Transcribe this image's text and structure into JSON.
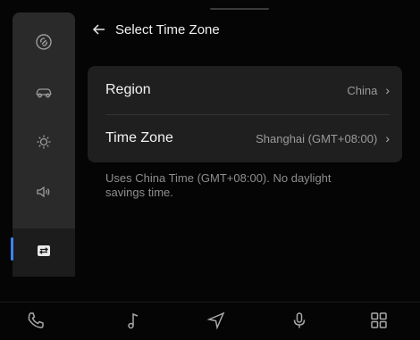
{
  "header": {
    "title": "Select Time Zone"
  },
  "sidebar": {
    "items": [
      {
        "icon": "link-icon"
      },
      {
        "icon": "car-icon"
      },
      {
        "icon": "brightness-icon"
      },
      {
        "icon": "volume-icon"
      },
      {
        "icon": "transfer-icon",
        "active": true
      }
    ]
  },
  "settings": {
    "region": {
      "label": "Region",
      "value": "China"
    },
    "time_zone": {
      "label": "Time Zone",
      "value": "Shanghai (GMT+08:00)"
    },
    "note": "Uses China Time (GMT+08:00). No daylight savings time."
  },
  "bottom_bar": {
    "items": [
      "phone-icon",
      "music-icon",
      "navigation-icon",
      "microphone-icon",
      "apps-grid-icon"
    ]
  },
  "colors": {
    "accent": "#3b82f6",
    "card": "#1f1f1f",
    "sidebar": "#2a2a2a"
  }
}
